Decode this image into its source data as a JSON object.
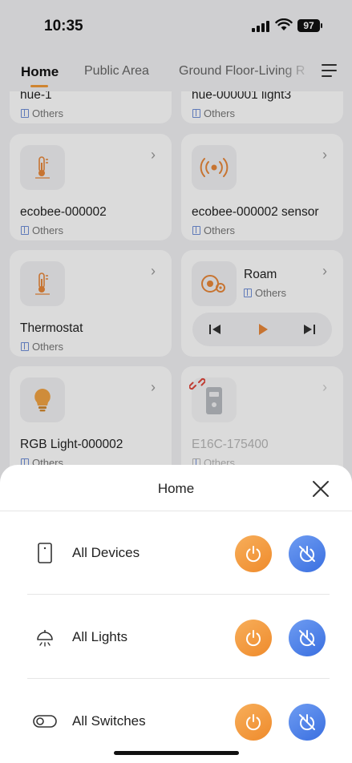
{
  "status_bar": {
    "time": "10:35",
    "battery": "97"
  },
  "tabs": [
    "Home",
    "Public Area",
    "Ground Floor-Living R"
  ],
  "cards": [
    {
      "name": "hue-1",
      "room": "Others",
      "icon": "bulb-icon"
    },
    {
      "name": "hue-000001 light3",
      "room": "Others",
      "icon": "bulb-icon"
    },
    {
      "name": "ecobee-000002",
      "room": "Others",
      "icon": "thermometer-icon"
    },
    {
      "name": "ecobee-000002 sensor",
      "room": "Others",
      "icon": "sensor-icon"
    },
    {
      "name": "Thermostat",
      "room": "Others",
      "icon": "thermometer-icon"
    },
    {
      "name": "Roam",
      "room": "Others",
      "icon": "speaker-icon"
    },
    {
      "name": "RGB Light-000002",
      "room": "Others",
      "icon": "bulb-icon"
    },
    {
      "name": "E16C-175400",
      "room": "Others",
      "icon": "doorbell-icon",
      "offline": true
    }
  ],
  "sheet": {
    "title": "Home",
    "rows": [
      {
        "label": "All Devices",
        "icon": "phone-device-icon"
      },
      {
        "label": "All Lights",
        "icon": "lamp-icon"
      },
      {
        "label": "All Switches",
        "icon": "toggle-switch-icon"
      }
    ]
  },
  "colors": {
    "accent_orange": "#f29a38",
    "accent_blue": "#3a6fe0"
  }
}
